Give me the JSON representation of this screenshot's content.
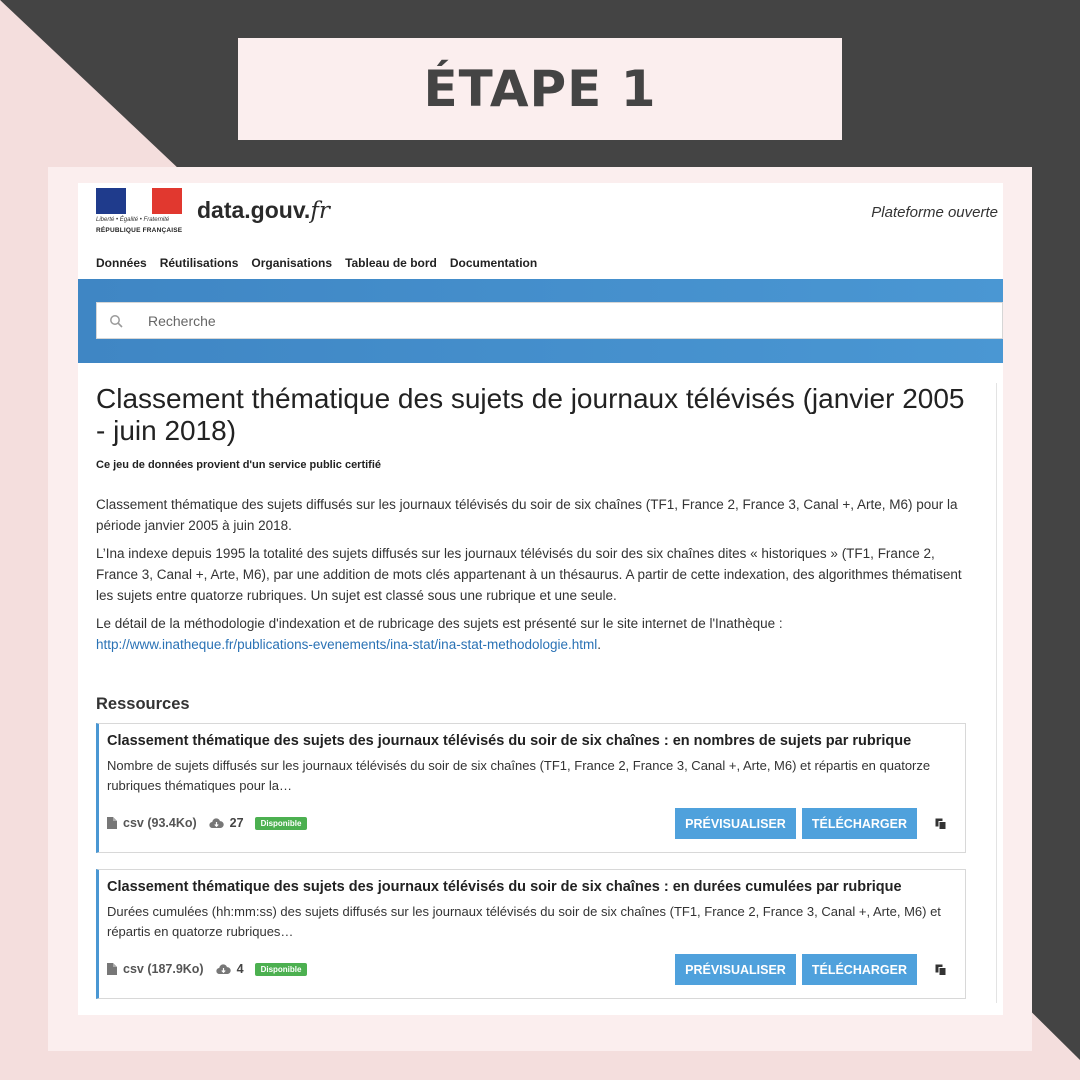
{
  "slide": {
    "title": "ÉTAPE 1"
  },
  "header": {
    "motto": "Liberté • Égalité • Fraternité",
    "republic": "RÉPUBLIQUE FRANÇAISE",
    "site_name": "data.gouv.",
    "site_tld": "fr",
    "tagline": "Plateforme ouverte"
  },
  "nav": {
    "items": [
      "Données",
      "Réutilisations",
      "Organisations",
      "Tableau de bord",
      "Documentation"
    ]
  },
  "search": {
    "placeholder": "Recherche"
  },
  "dataset": {
    "title": "Classement thématique des sujets de journaux télévisés (janvier 2005 - juin 2018)",
    "certified": "Ce jeu de données provient d'un service public certifié",
    "paragraphs": [
      "Classement thématique des sujets diffusés sur les journaux télévisés du soir de six chaînes (TF1, France 2, France 3, Canal +, Arte, M6) pour la période janvier 2005 à juin 2018.",
      "L’Ina indexe depuis 1995 la totalité des sujets diffusés sur les journaux télévisés du soir des six chaînes dites « historiques » (TF1, France 2, France 3, Canal +, Arte, M6), par une addition de mots clés appartenant à un thésaurus. A partir de cette indexation, des algorithmes thématisent les sujets entre quatorze rubriques. Un sujet est classé sous une rubrique et une seule.",
      "Le détail de la méthodologie d'indexation et de rubricage des sujets est présenté sur le site internet de l'Inathèque :"
    ],
    "link": "http://www.inatheque.fr/publications-evenements/ina-stat/ina-stat-methodologie.html",
    "link_suffix": "."
  },
  "resources": {
    "heading": "Ressources",
    "items": [
      {
        "title": "Classement thématique des sujets des journaux télévisés du soir de six chaînes : en nombres de sujets par rubrique",
        "description": "Nombre de sujets diffusés sur les journaux télévisés du soir de six chaînes (TF1, France 2, France 3, Canal +, Arte, M6) et répartis en quatorze rubriques thématiques pour la…",
        "format": "csv (93.4Ko)",
        "downloads": "27",
        "status": "Disponible",
        "preview_label": "PRÉVISUALISER",
        "download_label": "TÉLÉCHARGER"
      },
      {
        "title": "Classement thématique des sujets des journaux télévisés du soir de six chaînes : en durées cumulées par rubrique",
        "description": "Durées cumulées (hh:mm:ss) des sujets diffusés sur les journaux télévisés du soir de six chaînes (TF1, France 2, France 3, Canal +, Arte, M6) et répartis en quatorze rubriques…",
        "format": "csv (187.9Ko)",
        "downloads": "4",
        "status": "Disponible",
        "preview_label": "PRÉVISUALISER",
        "download_label": "TÉLÉCHARGER"
      }
    ]
  },
  "colors": {
    "accent": "#4fa1dc",
    "badge": "#4cb050",
    "link": "#2a72b5",
    "slide_dark": "#444444",
    "slide_pink": "#f4dedd"
  },
  "icons": [
    "search-icon",
    "file-icon",
    "cloud-download-icon",
    "copy-icon"
  ]
}
